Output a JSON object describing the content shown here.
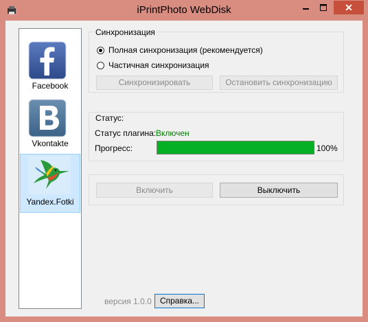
{
  "window": {
    "title": "iPrintPhoto WebDisk",
    "close_glyph": "✕",
    "accent": "#d98c80",
    "close_color": "#c7503c"
  },
  "sidebar": {
    "items": [
      {
        "label": "Facebook",
        "icon": "facebook-icon",
        "selected": false
      },
      {
        "label": "Vkontakte",
        "icon": "vkontakte-icon",
        "selected": false
      },
      {
        "label": "Yandex.Fotki",
        "icon": "hummingbird-icon",
        "selected": true
      }
    ]
  },
  "sync": {
    "title": "Синхронизация",
    "option_full": "Полная синхронизация (рекомендуется)",
    "option_partial": "Частичная синхронизация",
    "selected": "full",
    "sync_button": "Синхронизировать",
    "stop_button": "Остановить синхронизацию"
  },
  "status": {
    "title": "Статус:",
    "plugin_label": "Статус плагина:",
    "plugin_value": "Включен",
    "plugin_value_color": "#008000",
    "progress_label": "Прогресс:",
    "progress_percent": "100%",
    "progress_fraction": 1.0,
    "progress_color": "#06b025"
  },
  "actions": {
    "enable_button": "Включить",
    "disable_button": "Выключить"
  },
  "footer": {
    "version": "версия 1.0.0",
    "help_button": "Справка..."
  }
}
